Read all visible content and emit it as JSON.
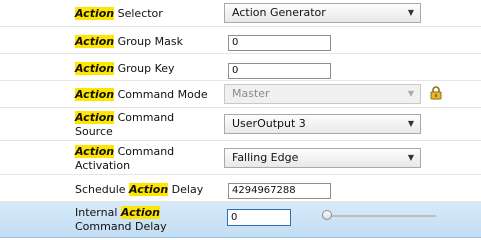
{
  "highlight_word": "Action",
  "rows": [
    {
      "pre": "",
      "post": " Selector",
      "line2": "",
      "control": "dropdown",
      "value": "Action Generator"
    },
    {
      "pre": "",
      "post": " Group Mask",
      "line2": "",
      "control": "textbox",
      "value": "0"
    },
    {
      "pre": "",
      "post": " Group Key",
      "line2": "",
      "control": "textbox",
      "value": "0"
    },
    {
      "pre": "",
      "post": " Command Mode",
      "line2": "",
      "control": "dropdown-disabled",
      "value": "Master",
      "icon": "lock-icon"
    },
    {
      "pre": "",
      "post": " Command",
      "line2": "Source",
      "control": "dropdown",
      "value": "UserOutput 3"
    },
    {
      "pre": "",
      "post": " Command",
      "line2": "Activation",
      "control": "dropdown",
      "value": "Falling Edge"
    },
    {
      "pre": "Schedule ",
      "post": " Delay",
      "line2": "",
      "control": "textbox",
      "value": "4294967288"
    },
    {
      "pre": "Internal ",
      "post": "",
      "line2": "Command Delay",
      "control": "textbox-slider",
      "value": "0",
      "selected": true,
      "slider_value": 0
    }
  ]
}
